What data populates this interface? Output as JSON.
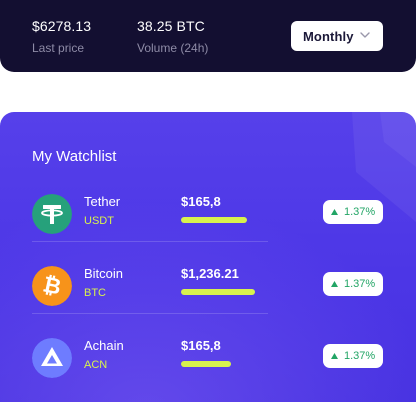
{
  "stats": {
    "last_price": {
      "value": "$6278.13",
      "label": "Last price"
    },
    "volume": {
      "value": "38.25 BTC",
      "label": "Volume (24h)"
    },
    "period_select": {
      "selected": "Monthly"
    }
  },
  "watchlist": {
    "title": "My Watchlist",
    "items": [
      {
        "name": "Tether",
        "symbol": "USDT",
        "price": "$165,8",
        "change": "1.37%",
        "icon": "tether-icon",
        "icon_color": "#26a17b"
      },
      {
        "name": "Bitcoin",
        "symbol": "BTC",
        "price": "$1,236.21",
        "change": "1.37%",
        "icon": "bitcoin-icon",
        "icon_color": "#f7931a"
      },
      {
        "name": "Achain",
        "symbol": "ACN",
        "price": "$165,8",
        "change": "1.37%",
        "icon": "achain-icon",
        "icon_color": "#6e7cff"
      }
    ]
  },
  "colors": {
    "header_bg": "#130f31",
    "card_bg": "#5640ea",
    "accent_lime": "#d8f24e",
    "positive_green": "#22a565"
  }
}
